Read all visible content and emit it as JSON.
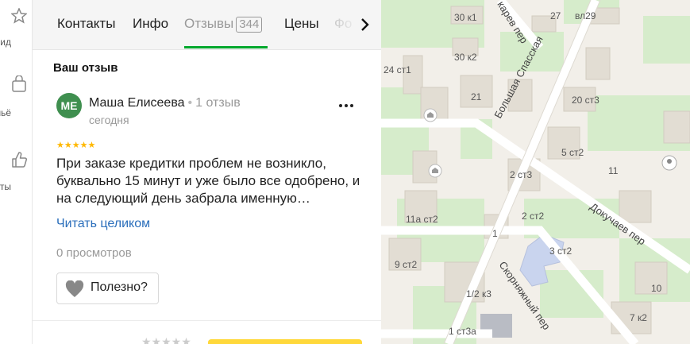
{
  "rail": {
    "items": [
      {
        "label": "ид",
        "icon": "star-icon"
      },
      {
        "label": "льё",
        "icon": "bag-icon"
      },
      {
        "label": "еты",
        "icon": "thumb-up-icon"
      }
    ]
  },
  "tabs": [
    {
      "label": "Контакты"
    },
    {
      "label": "Инфо"
    },
    {
      "label": "Отзывы",
      "badge": "344",
      "active": true
    },
    {
      "label": "Цены"
    },
    {
      "label": "Фо"
    }
  ],
  "review": {
    "section_title": "Ваш отзыв",
    "avatar_initials": "МЕ",
    "author": "Маша Елисеева",
    "separator": "•",
    "review_count": "1 отзыв",
    "date": "сегодня",
    "stars": "★★★★★",
    "rating": 5,
    "text": "При заказе кредитки проблем не возникло, буквально 15 минут и уже было все одобрено, и на следующий день забрала именную…",
    "read_more": "Читать целиком",
    "views": "0 просмотров",
    "helpful": "Полезно?"
  },
  "bottom": {
    "stars": "★★★★★"
  },
  "map": {
    "labels": [
      "30 к1",
      "27",
      "вл29",
      "30 к2",
      "24 ст1",
      "21",
      "20 ст3",
      "5 ст2",
      "2 ст3",
      "11",
      "11а ст2",
      "2 ст2",
      "1",
      "3 ст2",
      "9 ст2",
      "1/2 к3",
      "10",
      "1 ст3а",
      "7 к2"
    ],
    "streets": [
      "Большая Спасская",
      "Докучаев пер",
      "Скорняжный пер",
      "карев пер"
    ]
  },
  "colors": {
    "accent_green": "#00a82d",
    "link_blue": "#2a6ebb",
    "star_yellow": "#ffb800",
    "avatar_green": "#3f8f4f"
  }
}
